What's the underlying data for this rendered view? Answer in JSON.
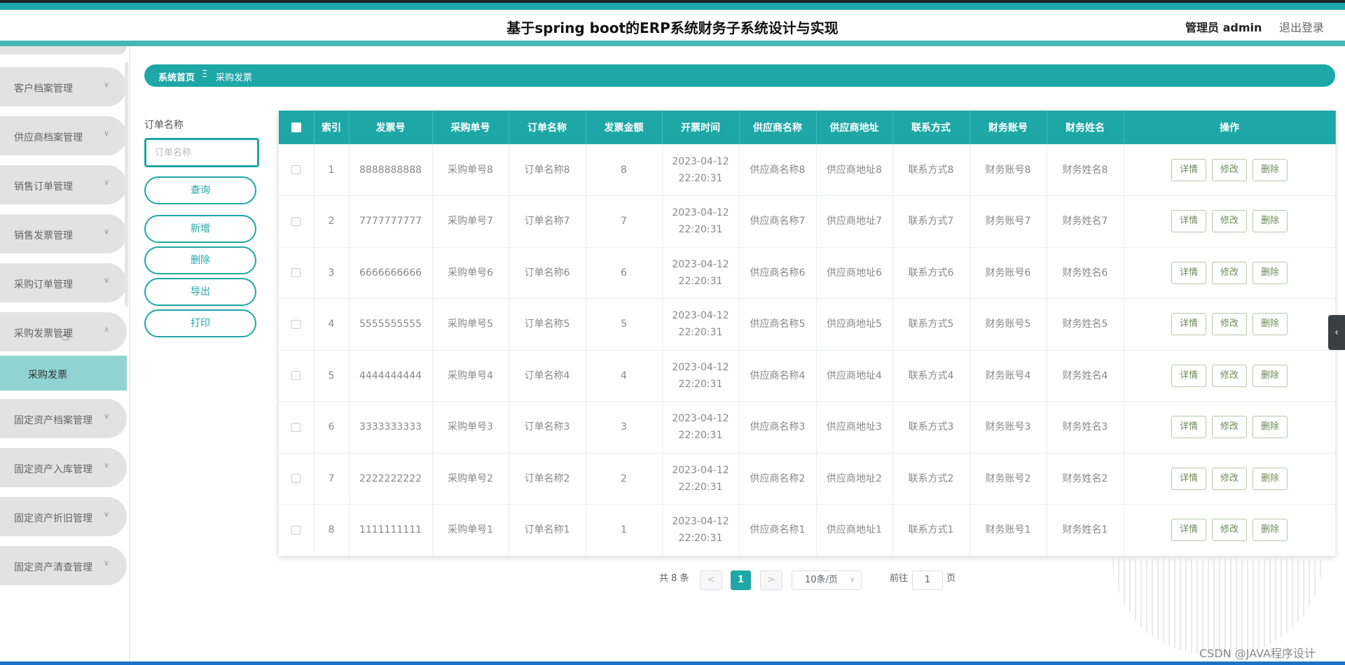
{
  "header": {
    "title": "基于spring boot的ERP系统财务子系统设计与实现",
    "user": "管理员 admin",
    "logout": "退出登录"
  },
  "sidebar": {
    "items": [
      {
        "label": "客户档案管理",
        "chevron": "chevron-down"
      },
      {
        "label": "供应商档案管理",
        "chevron": "chevron-down"
      },
      {
        "label": "销售订单管理",
        "chevron": "chevron-down"
      },
      {
        "label": "销售发票管理",
        "chevron": "chevron-down"
      },
      {
        "label": "采购订单管理",
        "chevron": "chevron-down"
      },
      {
        "label": "采购发票管理",
        "chevron": "chevron-up"
      },
      {
        "label": "固定资产档案管理",
        "chevron": "chevron-down"
      },
      {
        "label": "固定资产入库管理",
        "chevron": "chevron-down"
      },
      {
        "label": "固定资产折旧管理",
        "chevron": "chevron-down"
      },
      {
        "label": "固定资产清查管理",
        "chevron": "chevron-down"
      }
    ],
    "active_sub": "采购发票"
  },
  "breadcrumb": {
    "home": "系统首页",
    "separator": "Ξ",
    "current": "采购发票"
  },
  "search": {
    "label": "订单名称",
    "placeholder": "订单名称",
    "value": "",
    "query": "查询",
    "add": "新增",
    "delete": "删除",
    "export": "导出",
    "print": "打印"
  },
  "table": {
    "columns": [
      "索引",
      "发票号",
      "采购单号",
      "订单名称",
      "发票金额",
      "开票时间",
      "供应商名称",
      "供应商地址",
      "联系方式",
      "财务账号",
      "财务姓名",
      "操作"
    ],
    "actions": {
      "detail": "详情",
      "edit": "修改",
      "delete": "删除"
    },
    "rows": [
      {
        "index": "1",
        "invoice": "8888888888",
        "po": "采购单号8",
        "order": "订单名称8",
        "amount": "8",
        "date": "2023-04-12",
        "time": "22:20:31",
        "supplier": "供应商名称8",
        "address": "供应商地址8",
        "contact": "联系方式8",
        "account": "财务账号8",
        "finance_name": "财务姓名8"
      },
      {
        "index": "2",
        "invoice": "7777777777",
        "po": "采购单号7",
        "order": "订单名称7",
        "amount": "7",
        "date": "2023-04-12",
        "time": "22:20:31",
        "supplier": "供应商名称7",
        "address": "供应商地址7",
        "contact": "联系方式7",
        "account": "财务账号7",
        "finance_name": "财务姓名7"
      },
      {
        "index": "3",
        "invoice": "6666666666",
        "po": "采购单号6",
        "order": "订单名称6",
        "amount": "6",
        "date": "2023-04-12",
        "time": "22:20:31",
        "supplier": "供应商名称6",
        "address": "供应商地址6",
        "contact": "联系方式6",
        "account": "财务账号6",
        "finance_name": "财务姓名6"
      },
      {
        "index": "4",
        "invoice": "5555555555",
        "po": "采购单号5",
        "order": "订单名称5",
        "amount": "5",
        "date": "2023-04-12",
        "time": "22:20:31",
        "supplier": "供应商名称5",
        "address": "供应商地址5",
        "contact": "联系方式5",
        "account": "财务账号5",
        "finance_name": "财务姓名5"
      },
      {
        "index": "5",
        "invoice": "4444444444",
        "po": "采购单号4",
        "order": "订单名称4",
        "amount": "4",
        "date": "2023-04-12",
        "time": "22:20:31",
        "supplier": "供应商名称4",
        "address": "供应商地址4",
        "contact": "联系方式4",
        "account": "财务账号4",
        "finance_name": "财务姓名4"
      },
      {
        "index": "6",
        "invoice": "3333333333",
        "po": "采购单号3",
        "order": "订单名称3",
        "amount": "3",
        "date": "2023-04-12",
        "time": "22:20:31",
        "supplier": "供应商名称3",
        "address": "供应商地址3",
        "contact": "联系方式3",
        "account": "财务账号3",
        "finance_name": "财务姓名3"
      },
      {
        "index": "7",
        "invoice": "2222222222",
        "po": "采购单号2",
        "order": "订单名称2",
        "amount": "2",
        "date": "2023-04-12",
        "time": "22:20:31",
        "supplier": "供应商名称2",
        "address": "供应商地址2",
        "contact": "联系方式2",
        "account": "财务账号2",
        "finance_name": "财务姓名2"
      },
      {
        "index": "8",
        "invoice": "1111111111",
        "po": "采购单号1",
        "order": "订单名称1",
        "amount": "1",
        "date": "2023-04-12",
        "time": "22:20:31",
        "supplier": "供应商名称1",
        "address": "供应商地址1",
        "contact": "联系方式1",
        "account": "财务账号1",
        "finance_name": "财务姓名1"
      }
    ]
  },
  "pagination": {
    "total": "共 8 条",
    "prev": "<",
    "current": "1",
    "next": ">",
    "page_size": "10条/页",
    "goto_label": "前往",
    "goto_value": "1",
    "page_unit": "页"
  },
  "side_tab": "‹",
  "watermark": "CSDN @JAVA程序设计",
  "colors": {
    "accent": "#1ea7a7",
    "menu_bg": "#e2e2e2",
    "active_sub": "#8fd4d0"
  }
}
